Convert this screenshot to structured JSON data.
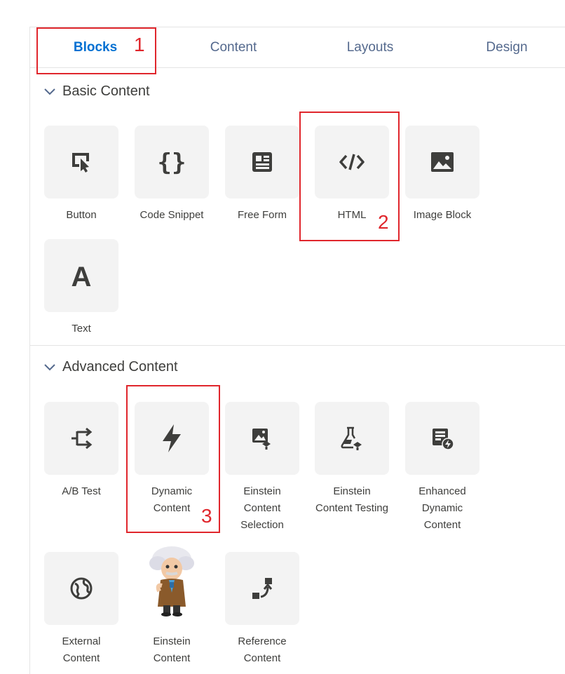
{
  "tabs": [
    {
      "label": "Blocks",
      "active": true
    },
    {
      "label": "Content",
      "active": false
    },
    {
      "label": "Layouts",
      "active": false
    },
    {
      "label": "Design",
      "active": false
    }
  ],
  "sections": {
    "basic": {
      "title": "Basic Content",
      "items": [
        {
          "label": "Button",
          "icon": "button-click-icon"
        },
        {
          "label": "Code Snippet",
          "icon": "curly-braces-icon"
        },
        {
          "label": "Free Form",
          "icon": "free-form-icon"
        },
        {
          "label": "HTML",
          "icon": "html-code-icon"
        },
        {
          "label": "Image Block",
          "icon": "image-icon"
        },
        {
          "label": "Text",
          "icon": "text-a-icon"
        }
      ]
    },
    "advanced": {
      "title": "Advanced Content",
      "items": [
        {
          "label_lines": [
            "A/B Test"
          ],
          "icon": "ab-test-icon"
        },
        {
          "label_lines": [
            "Dynamic",
            "Content"
          ],
          "icon": "lightning-icon"
        },
        {
          "label_lines": [
            "Einstein",
            "Content",
            "Selection"
          ],
          "icon": "einstein-selection-icon"
        },
        {
          "label_lines": [
            "Einstein",
            "Content Testing"
          ],
          "icon": "flask-icon"
        },
        {
          "label_lines": [
            "Enhanced",
            "Dynamic",
            "Content"
          ],
          "icon": "enhanced-dynamic-icon"
        },
        {
          "label_lines": [
            "External",
            "Content"
          ],
          "icon": "globe-icon"
        },
        {
          "label_lines": [
            "Einstein",
            "Content"
          ],
          "icon": "einstein-character-icon"
        },
        {
          "label_lines": [
            "Reference",
            "Content"
          ],
          "icon": "reference-icon"
        }
      ]
    }
  },
  "annotations": [
    "1",
    "2",
    "3"
  ],
  "colors": {
    "accent": "#0070d2",
    "annotation": "#e0262c",
    "tile": "#f3f3f3",
    "icon": "#3e3e3c"
  }
}
